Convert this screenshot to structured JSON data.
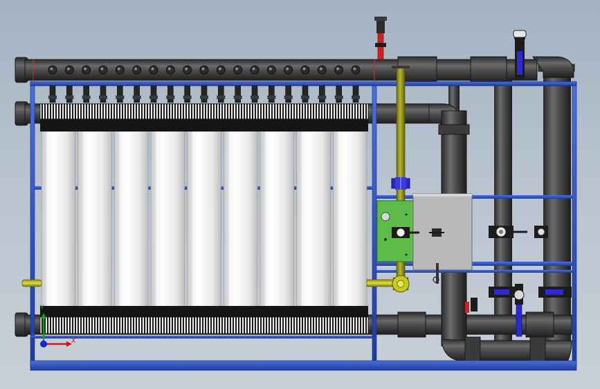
{
  "scene": {
    "background_top": "#a3b2c2",
    "background_bottom": "#c9d0d8",
    "module_count": 19,
    "membrane_column_count": 9,
    "colors": {
      "frame": "#2f55c8",
      "pipe": "#454545",
      "membrane": "#f4f4f4",
      "yellow_pipe": "#8a8a10",
      "green_panel": "#5dbb4a",
      "control_box": "#b8b8b8",
      "valve_blue": "#2a2ad0",
      "valve_red": "#d02020"
    }
  },
  "axis_triad": {
    "x_label": "X",
    "y_label": "Y",
    "x_color": "#d01818",
    "y_color": "#14a014",
    "z_color": "#1428d8"
  }
}
